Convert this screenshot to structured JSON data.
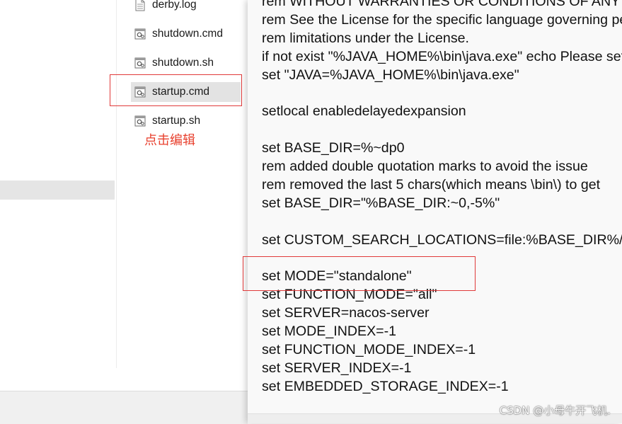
{
  "explorer": {
    "files": [
      {
        "name": "derby.log",
        "icon": "text-file-icon"
      },
      {
        "name": "shutdown.cmd",
        "icon": "gear-script-icon"
      },
      {
        "name": "shutdown.sh",
        "icon": "gear-script-icon"
      },
      {
        "name": "startup.cmd",
        "icon": "gear-script-icon",
        "selected": true
      },
      {
        "name": "startup.sh",
        "icon": "gear-script-icon"
      }
    ],
    "annotation": "点击编辑"
  },
  "editor": {
    "lines": [
      "rem WITHOUT WARRANTIES OR CONDITIONS OF ANY KIND",
      "rem See the License for the specific language governing permissions and",
      "rem limitations under the License.",
      "if not exist \"%JAVA_HOME%\\bin\\java.exe\" echo Please set the JAVA_HOME",
      "set \"JAVA=%JAVA_HOME%\\bin\\java.exe\"",
      "",
      "setlocal enabledelayedexpansion",
      "",
      "set BASE_DIR=%~dp0",
      "rem added double quotation marks to avoid the issue",
      "rem removed the last 5 chars(which means \\bin\\) to get",
      "set BASE_DIR=\"%BASE_DIR:~0,-5%\"",
      "",
      "set CUSTOM_SEARCH_LOCATIONS=file:%BASE_DIR%/conf/",
      "",
      "set MODE=\"standalone\"",
      "set FUNCTION_MODE=\"all\"",
      "set SERVER=nacos-server",
      "set MODE_INDEX=-1",
      "set FUNCTION_MODE_INDEX=-1",
      "set SERVER_INDEX=-1",
      "set EMBEDDED_STORAGE_INDEX=-1"
    ]
  },
  "colors": {
    "annotation_red": "#e8402e",
    "highlight_box": "#e03a3a",
    "selection_bg": "#e3e3e3"
  },
  "watermark": "CSDN @小母牛开飞机."
}
